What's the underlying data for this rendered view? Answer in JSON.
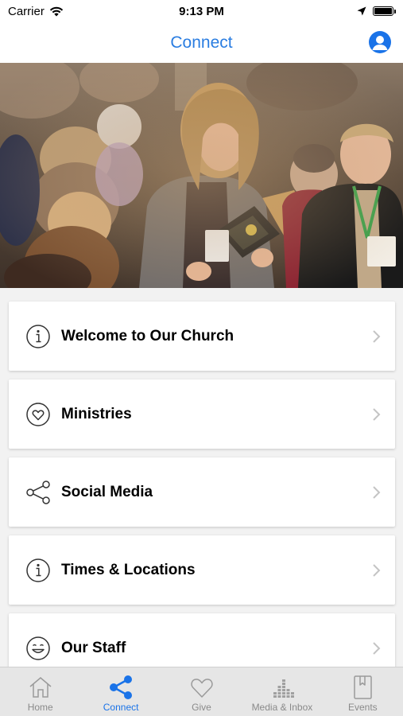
{
  "status_bar": {
    "carrier": "Carrier",
    "time": "9:13 PM"
  },
  "nav": {
    "title": "Connect",
    "profile_icon": "person-circle-icon"
  },
  "hero": {
    "description_icon": "church-greeting-photo"
  },
  "menu": {
    "items": [
      {
        "label": "Welcome to Our Church",
        "icon": "info-circle-icon"
      },
      {
        "label": "Ministries",
        "icon": "heart-circle-icon"
      },
      {
        "label": "Social Media",
        "icon": "share-icon"
      },
      {
        "label": "Times & Locations",
        "icon": "info-circle-icon"
      },
      {
        "label": "Our Staff",
        "icon": "smiley-icon"
      }
    ]
  },
  "tabs": {
    "items": [
      {
        "label": "Home",
        "icon": "home-icon",
        "active": false
      },
      {
        "label": "Connect",
        "icon": "share-icon",
        "active": true
      },
      {
        "label": "Give",
        "icon": "heart-icon",
        "active": false
      },
      {
        "label": "Media & Inbox",
        "icon": "equalizer-icon",
        "active": false
      },
      {
        "label": "Events",
        "icon": "bookmark-book-icon",
        "active": false
      }
    ]
  },
  "colors": {
    "accent": "#1a73e8",
    "title": "#2a7de1",
    "inactive": "#8a8a8a"
  }
}
